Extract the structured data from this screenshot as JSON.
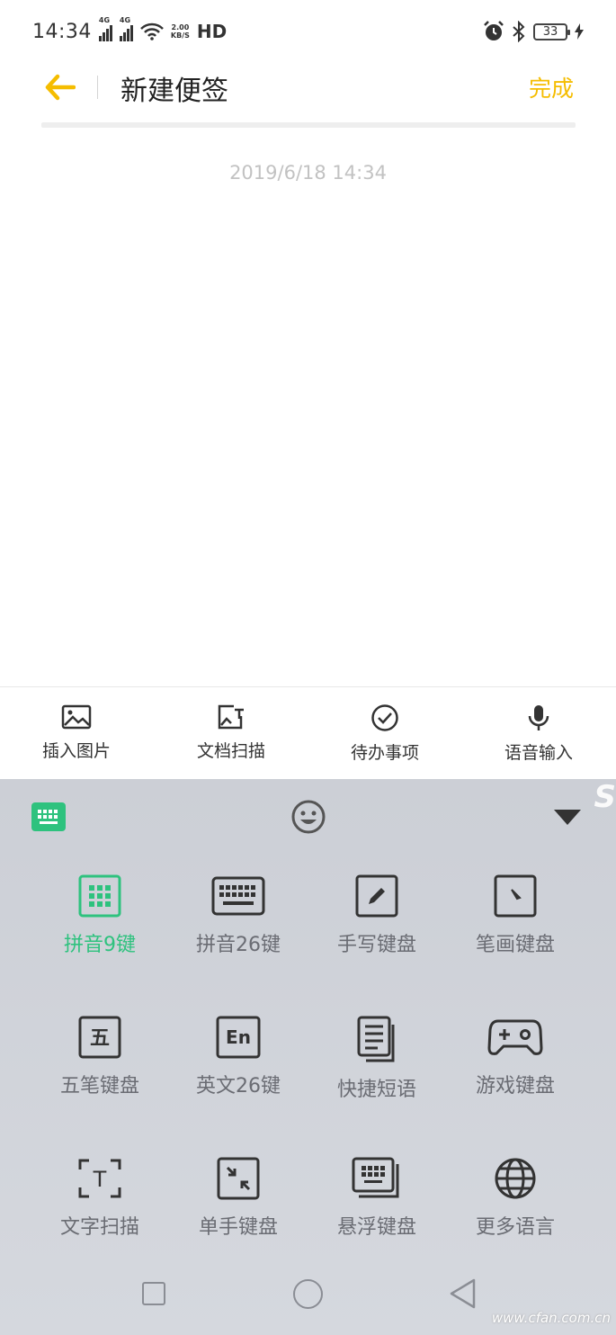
{
  "status_bar": {
    "time": "14:34",
    "network1": "4G",
    "network2": "4G",
    "speed_value": "2.00",
    "speed_unit": "KB/S",
    "hd": "HD",
    "battery": "33"
  },
  "header": {
    "title": "新建便签",
    "done_label": "完成"
  },
  "note": {
    "date": "2019/6/18 14:34"
  },
  "toolbar": {
    "items": [
      {
        "label": "插入图片",
        "icon": "image-icon"
      },
      {
        "label": "文档扫描",
        "icon": "doc-scan-icon"
      },
      {
        "label": "待办事项",
        "icon": "check-circle-icon"
      },
      {
        "label": "语音输入",
        "icon": "microphone-icon"
      }
    ]
  },
  "ime": {
    "watermark": "S",
    "modes": [
      {
        "label": "拼音9键",
        "icon": "grid-9-icon",
        "active": true
      },
      {
        "label": "拼音26键",
        "icon": "keyboard-icon"
      },
      {
        "label": "手写键盘",
        "icon": "pen-icon"
      },
      {
        "label": "笔画键盘",
        "icon": "stroke-icon"
      },
      {
        "label": "五笔键盘",
        "icon": "wubi-icon",
        "glyph": "五"
      },
      {
        "label": "英文26键",
        "icon": "english-icon",
        "glyph": "En"
      },
      {
        "label": "快捷短语",
        "icon": "phrases-icon"
      },
      {
        "label": "游戏键盘",
        "icon": "gamepad-icon"
      },
      {
        "label": "文字扫描",
        "icon": "text-scan-icon",
        "glyph": "T"
      },
      {
        "label": "单手键盘",
        "icon": "one-hand-icon"
      },
      {
        "label": "悬浮键盘",
        "icon": "floating-keyboard-icon"
      },
      {
        "label": "更多语言",
        "icon": "globe-icon"
      }
    ]
  },
  "watermark": "www.cfan.com.cn",
  "colors": {
    "accent_yellow": "#f5bd00",
    "accent_green": "#2ec27e"
  }
}
